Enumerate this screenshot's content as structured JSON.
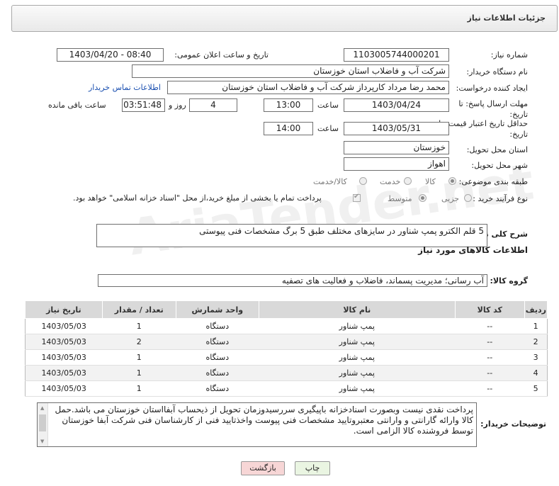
{
  "header": {
    "title": "جزئیات اطلاعات نیاز"
  },
  "fields": {
    "need_number_label": "شماره نیاز:",
    "need_number": "1103005744000201",
    "announce_label": "تاریخ و ساعت اعلان عمومی:",
    "announce_value": "1403/04/20 - 08:40",
    "buyer_org_label": "نام دستگاه خریدار:",
    "buyer_org": "شرکت آب و فاضلاب استان خوزستان",
    "creator_label": "ایجاد کننده درخواست:",
    "creator": "محمد رضا مرداد کارپرداز شرکت آب و فاضلاب استان خوزستان",
    "contact_link": "اطلاعات تماس خریدار",
    "reply_deadline_label": "مهلت ارسال پاسخ: تا تاریخ:",
    "reply_date": "1403/04/24",
    "time_label": "ساعت",
    "reply_time": "13:00",
    "days": "4",
    "days_and_label": "روز و",
    "remaining": "03:51:48",
    "remaining_label": "ساعت باقی مانده",
    "price_validity_label": "حداقل تاریخ اعتبار قیمت: تا تاریخ:",
    "price_date": "1403/05/31",
    "price_time": "14:00",
    "province_label": "استان محل تحویل:",
    "province": "خوزستان",
    "city_label": "شهر محل تحویل:",
    "city": "اهواز",
    "category_label": "طبقه بندی موضوعی:",
    "category_options": [
      "کالا",
      "خدمت",
      "کالا/خدمت"
    ],
    "process_label": "نوع فرآیند خرید :",
    "process_options": [
      "جزیی",
      "متوسط"
    ],
    "payment_note": "پرداخت تمام یا بخشی از مبلغ خرید،از محل \"اسناد خزانه اسلامی\" خواهد بود."
  },
  "summary": {
    "label": "شرح کلی نیاز:",
    "text": "5 قلم الکترو پمپ شناور در سایزهای مختلف طبق 5 برگ مشخصات فنی پیوستی"
  },
  "goods_section": {
    "title": "اطلاعات کالاهای مورد نیاز",
    "group_label": "گروه کالا:",
    "group_value": "آب رسانی؛ مدیریت پسماند، فاضلاب و فعالیت های تصفیه"
  },
  "table": {
    "headers": [
      "ردیف",
      "کد کالا",
      "نام کالا",
      "واحد شمارش",
      "تعداد / مقدار",
      "تاریخ نیاز"
    ],
    "rows": [
      [
        "1",
        "--",
        "پمپ شناور",
        "دستگاه",
        "1",
        "1403/05/03"
      ],
      [
        "2",
        "--",
        "پمپ شناور",
        "دستگاه",
        "2",
        "1403/05/03"
      ],
      [
        "3",
        "--",
        "پمپ شناور",
        "دستگاه",
        "1",
        "1403/05/03"
      ],
      [
        "4",
        "--",
        "پمپ شناور",
        "دستگاه",
        "1",
        "1403/05/03"
      ],
      [
        "5",
        "--",
        "پمپ شناور",
        "دستگاه",
        "1",
        "1403/05/03"
      ]
    ]
  },
  "buyer_notes": {
    "label": "توضیحات خریدار:",
    "text": "پرداخت نقدی نیست وبصورت اسنادخزانه باپیگیری سررسیدوزمان تحویل از ذیحساب آبفااستان خوزستان می باشد.حمل کالا وارائه گارانتی و وارانتی معتبروتایید مشخصات فنی پیوست واخذتایید فنی از کارشناسان فنی شرکت آبفا خوزستان توسط فروشنده کالا الزامی است."
  },
  "buttons": {
    "print": "چاپ",
    "back": "بازگشت"
  },
  "watermark": "AriaTender.net",
  "colors": {
    "link": "#1a4fb0",
    "back_button": "#f7d6d6",
    "print_button": "#eaf5e2"
  }
}
